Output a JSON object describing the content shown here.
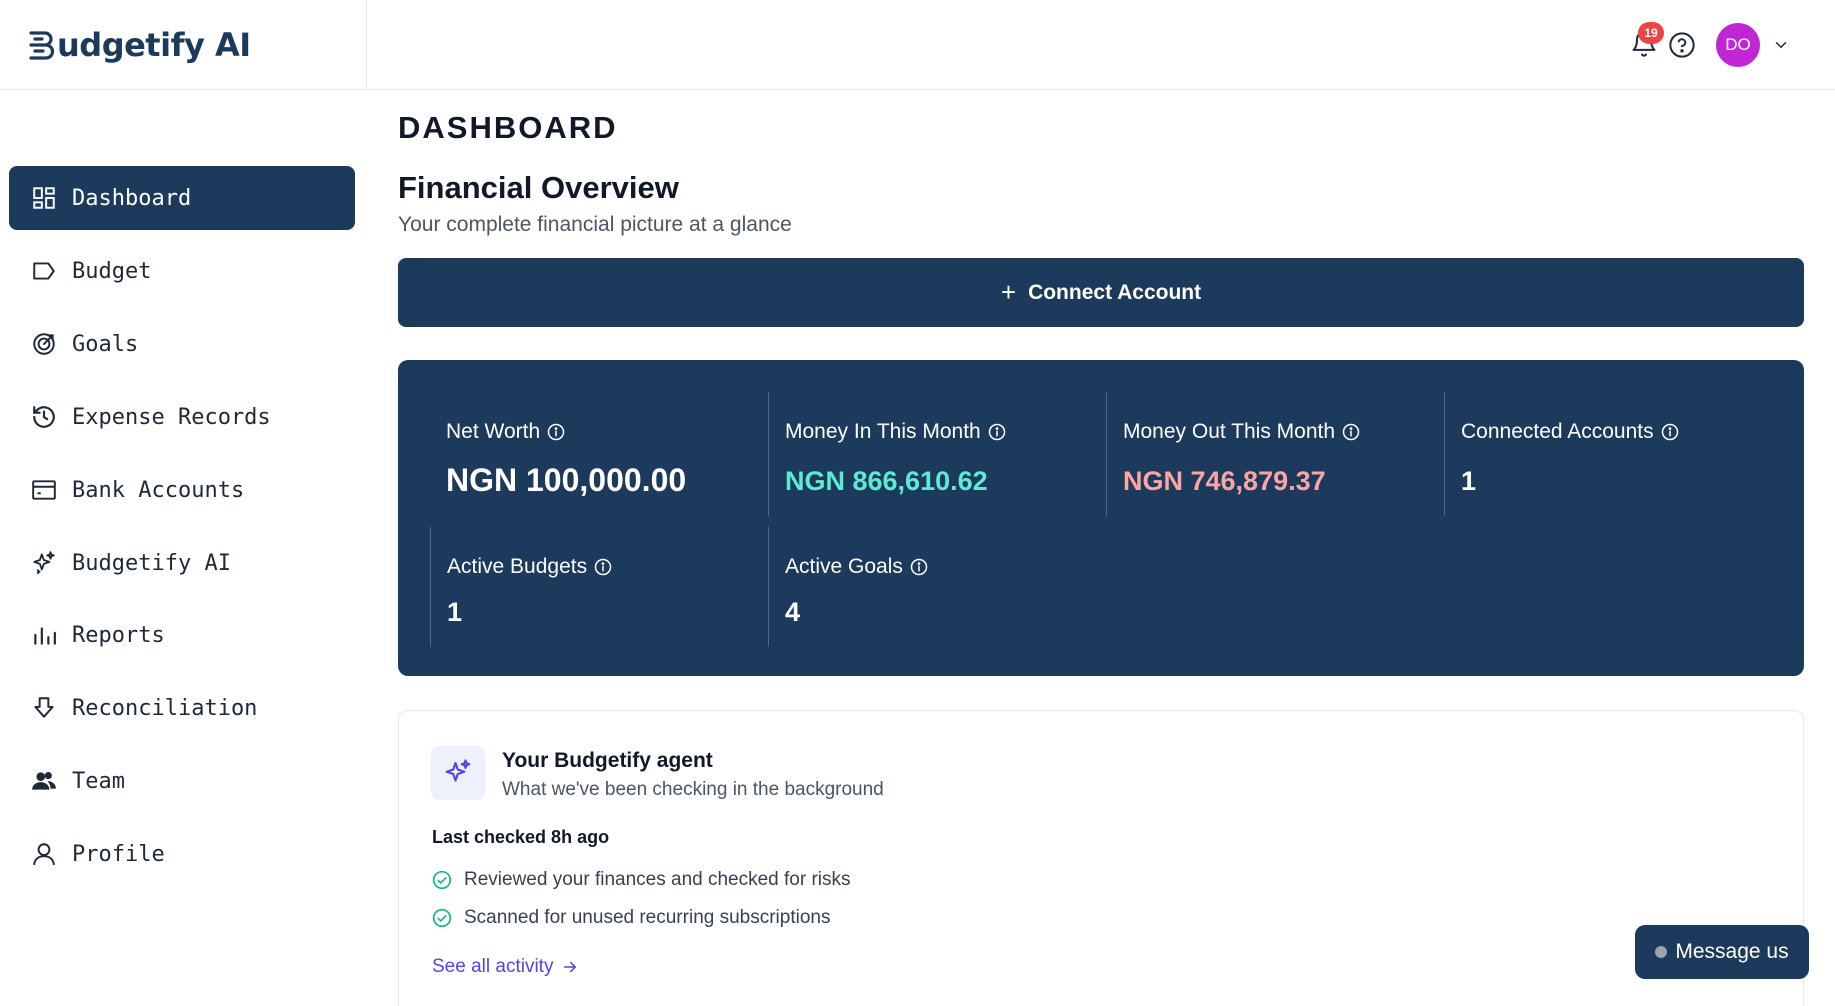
{
  "brand": {
    "name": "udgetify AI",
    "color": "#1b3a5c"
  },
  "header": {
    "notification_count": "19",
    "avatar_initials": "DO",
    "avatar_color": "#c026d3"
  },
  "sidebar": {
    "items": [
      {
        "label": "Dashboard",
        "icon": "grid-icon",
        "active": true
      },
      {
        "label": "Budget",
        "icon": "tag-icon"
      },
      {
        "label": "Goals",
        "icon": "target-icon"
      },
      {
        "label": "Expense Records",
        "icon": "history-icon"
      },
      {
        "label": "Bank Accounts",
        "icon": "card-icon"
      },
      {
        "label": "Budgetify AI",
        "icon": "sparkle-icon"
      },
      {
        "label": "Reports",
        "icon": "bar-chart-icon"
      },
      {
        "label": "Reconciliation",
        "icon": "arrow-down-box-icon"
      },
      {
        "label": "Team",
        "icon": "team-icon"
      },
      {
        "label": "Profile",
        "icon": "user-icon"
      }
    ]
  },
  "main": {
    "page_title": "DASHBOARD",
    "section_title": "Financial Overview",
    "section_subtitle": "Your complete financial picture at a glance",
    "connect_button": "Connect Account",
    "stats": [
      {
        "label": "Net Worth",
        "value": "NGN 100,000.00",
        "color": "#ffffff"
      },
      {
        "label": "Money In This Month",
        "value": "NGN 866,610.62",
        "color": "#5eead4"
      },
      {
        "label": "Money Out This Month",
        "value": "NGN 746,879.37",
        "color": "#fca5a5"
      },
      {
        "label": "Connected Accounts",
        "value": "1",
        "color": "#ffffff"
      },
      {
        "label": "Active Budgets",
        "value": "1",
        "color": "#ffffff"
      },
      {
        "label": "Active Goals",
        "value": "4",
        "color": "#ffffff"
      }
    ],
    "agent": {
      "title": "Your Budgetify agent",
      "subtitle": "What we've been checking in the background",
      "last_checked": "Last checked 8h ago",
      "checks": [
        "Reviewed your finances and checked for risks",
        "Scanned for unused recurring subscriptions"
      ],
      "see_all": "See all activity"
    }
  },
  "chat": {
    "label": "Message us"
  }
}
